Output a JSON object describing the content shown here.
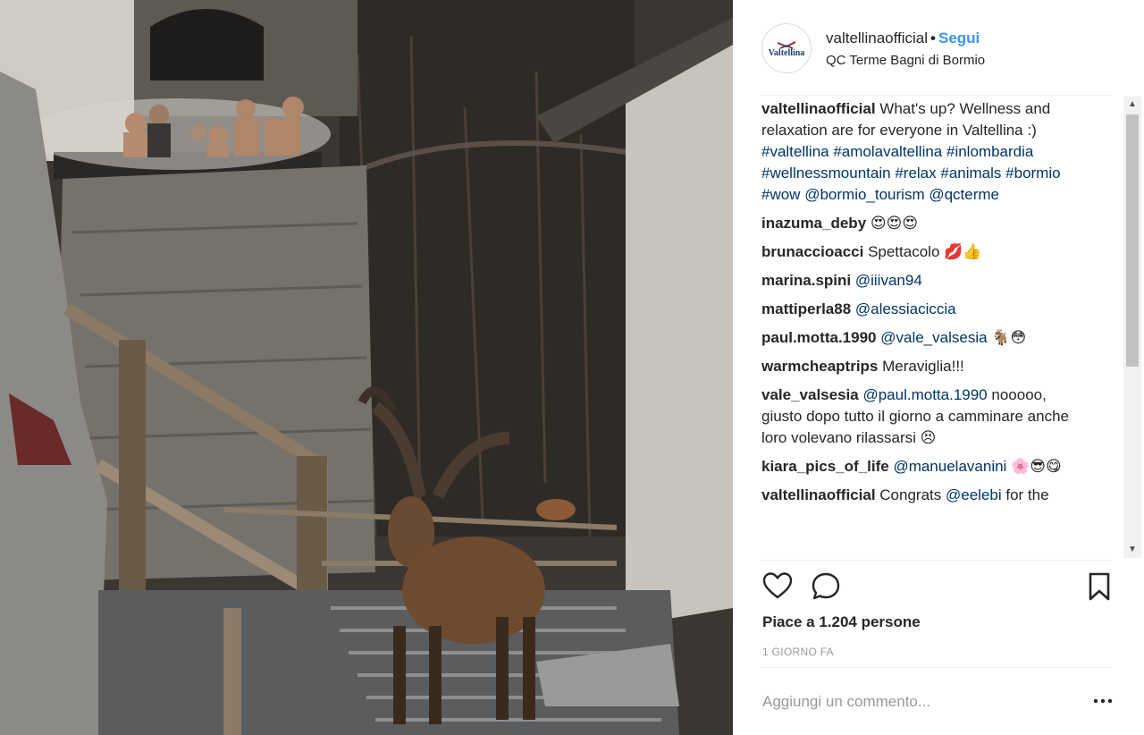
{
  "post": {
    "photo_alt": "Ibex on the stairs below a thermal pool in Bormio",
    "username": "valtellinaofficial",
    "separator": "•",
    "follow_label": "Segui",
    "location": "QC Terme Bagni di Bormio",
    "avatar_text": "Valtellina",
    "likes": "Piace a 1.204 persone",
    "date": "1 GIORNO FA",
    "add_comment_placeholder": "Aggiungi un commento..."
  },
  "caption": {
    "user": "valtellinaofficial",
    "text": "What's up? Wellness and relaxation are for everyone in Valtellina :)",
    "tags": [
      "#valtellina",
      "#amolavaltellina",
      "#inlombardia",
      "#wellnessmountain",
      "#relax",
      "#animals",
      "#bormio",
      "#wow",
      "@bormio_tourism",
      "@qcterme"
    ]
  },
  "comments": [
    {
      "user": "inazuma_deby",
      "text": "",
      "mention": "",
      "after": "",
      "emoji": "😍😍😍"
    },
    {
      "user": "brunaccioacci",
      "text": "Spettacolo",
      "mention": "",
      "after": "",
      "emoji": "💋👍"
    },
    {
      "user": "marina.spini",
      "text": "",
      "mention": "@iiivan94",
      "after": "",
      "emoji": ""
    },
    {
      "user": "mattiperla88",
      "text": "",
      "mention": "@alessiaciccia",
      "after": "",
      "emoji": ""
    },
    {
      "user": "paul.motta.1990",
      "text": "",
      "mention": "@vale_valsesia",
      "after": "",
      "emoji": "🐐😳"
    },
    {
      "user": "warmcheaptrips",
      "text": "Meraviglia!!!",
      "mention": "",
      "after": "",
      "emoji": ""
    },
    {
      "user": "vale_valsesia",
      "text": "",
      "mention": "@paul.motta.1990",
      "after": "nooooo, giusto dopo tutto il giorno a camminare anche loro volevano rilassarsi",
      "emoji": "😣"
    },
    {
      "user": "kiara_pics_of_life",
      "text": "",
      "mention": "@manuelavanini",
      "after": "",
      "emoji": "🌸😎😋"
    },
    {
      "user": "valtellinaofficial",
      "text": "Congrats",
      "mention": "@eelebi",
      "after": "for the",
      "emoji": ""
    }
  ],
  "icons": {
    "like": "heart-icon",
    "comment": "comment-icon",
    "save": "bookmark-icon",
    "more": "more-options-icon"
  },
  "colors": {
    "link_blue": "#3897f0",
    "tag_blue": "#003569",
    "muted": "#999999",
    "text": "#262626"
  }
}
